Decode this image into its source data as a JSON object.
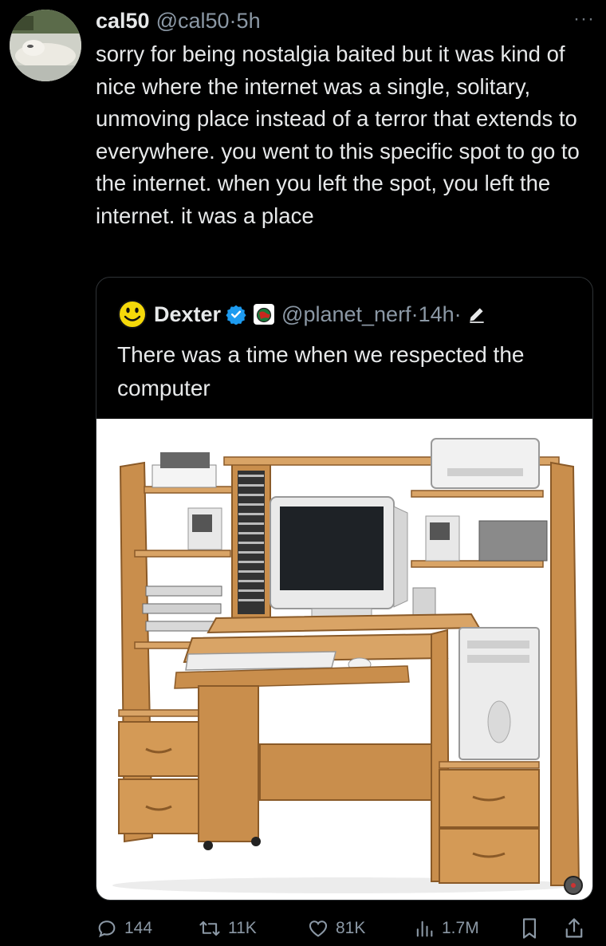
{
  "post": {
    "author_name": "cal50",
    "author_handle": "@cal50",
    "separator": "·",
    "time": "5h",
    "more": "···",
    "text": "sorry for being nostalgia baited but it was kind of nice where the internet was a single, solitary, unmoving place instead of a terror that extends to everywhere. you went to this specific spot to go to the internet.  when you left the spot, you left the internet. it was a place"
  },
  "quote": {
    "author_name": "Dexter",
    "author_handle": "@planet_nerf",
    "separator": "·",
    "time": "14h",
    "separator2": "·",
    "text": "There was a time when we respected the computer",
    "verified_icon": "verified-badge-icon",
    "affiliate_icon": "globe-badge-icon",
    "image_subject": "computer desk with CRT monitor, tower PC, printer, speakers, keyboard and CD rack"
  },
  "actions": {
    "replies": "144",
    "reposts": "11K",
    "likes": "81K",
    "views": "1.7M"
  },
  "colors": {
    "background": "#000000",
    "text": "#e7e9ea",
    "muted": "#8b98a5",
    "border": "#2f3336",
    "verified": "#1d9bf0",
    "wood": "#c98e4c"
  }
}
